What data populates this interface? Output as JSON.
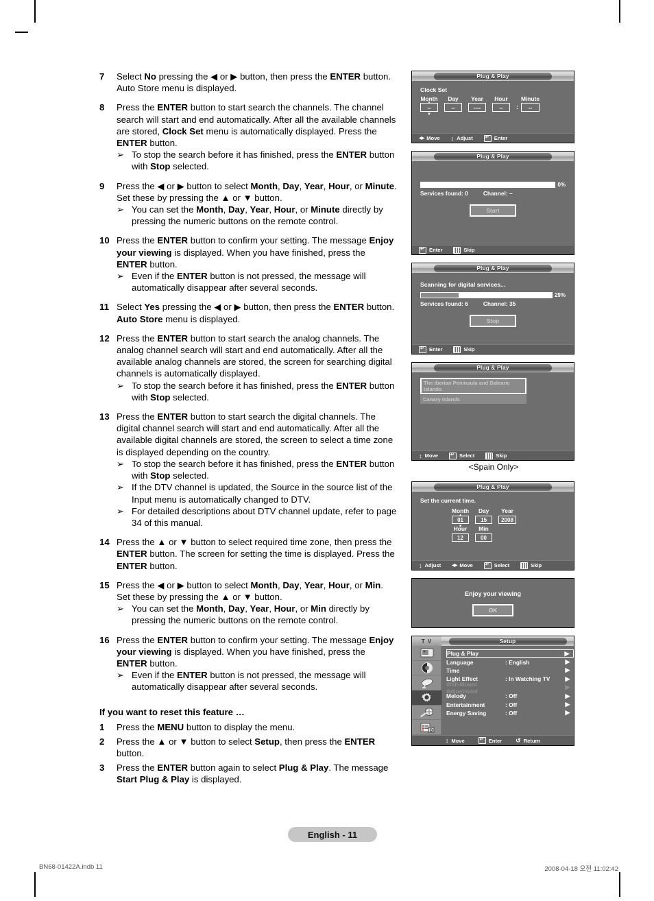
{
  "page": {
    "page_label": "English - 11",
    "footer_left": "BN68-01422A.indb   11",
    "footer_right": "2008-04-18   오전 11:02:42",
    "spain_caption": "<Spain Only>"
  },
  "steps": [
    {
      "num": "7",
      "lines": [
        "Select <b>No</b> pressing the ◀ or ▶ button, then press the <b>ENTER</b> button. Auto Store menu is displayed."
      ],
      "notes": []
    },
    {
      "num": "8",
      "lines": [
        "Press the <b>ENTER</b> button to start search the channels. The channel search will start and end automatically. After all the available channels are stored, <b>Clock Set</b> menu is automatically displayed. Press the <b>ENTER</b> button."
      ],
      "notes": [
        "To stop the search before it has finished, press the <b>ENTER</b> button with <b>Stop</b> selected."
      ]
    },
    {
      "num": "9",
      "lines": [
        "Press the ◀ or ▶ button to select <b>Month</b>, <b>Day</b>, <b>Year</b>, <b>Hour</b>, or <b>Minute</b>. Set these by pressing the ▲ or ▼ button."
      ],
      "notes": [
        "You can set the <b>Month</b>, <b>Day</b>, <b>Year</b>, <b>Hour</b>, or <b>Minute</b> directly by pressing the numeric buttons on the remote control."
      ]
    },
    {
      "num": "10",
      "lines": [
        "Press the <b>ENTER</b> button to confirm your setting. The message <b>Enjoy your viewing</b> is displayed. When you have finished, press the <b>ENTER</b> button."
      ],
      "notes": [
        "Even if the <b>ENTER</b> button is not pressed, the message will automatically disappear after several seconds."
      ]
    },
    {
      "num": "11",
      "lines": [
        "Select <b>Yes</b> pressing the ◀ or ▶ button, then press the <b>ENTER</b> button. <b>Auto Store</b> menu is displayed."
      ],
      "notes": []
    },
    {
      "num": "12",
      "lines": [
        "Press the <b>ENTER</b> button to start search the analog channels. The analog channel search will start and end automatically. After all the available analog channels are stored, the screen for searching digital channels is automatically displayed."
      ],
      "notes": [
        "To stop the search before it has finished, press the <b>ENTER</b> button with <b>Stop</b> selected."
      ]
    },
    {
      "num": "13",
      "lines": [
        "Press the <b>ENTER</b> button to start search the digital channels. The digital channel search will start and end automatically. After all the available digital channels are stored, the screen to select a time zone is displayed depending on the country."
      ],
      "notes": [
        "To stop the search before it has finished, press the <b>ENTER</b> button with <b>Stop</b> selected.",
        "If the DTV channel is updated, the Source in the source list of the Input menu is automatically changed to DTV.",
        "For detailed descriptions about DTV channel update, refer to page 34 of this manual."
      ]
    },
    {
      "num": "14",
      "lines": [
        "Press the ▲ or ▼ button to select required time zone, then press the <b>ENTER</b> button. The screen for setting the time is displayed. Press the <b>ENTER</b> button."
      ],
      "notes": []
    },
    {
      "num": "15",
      "lines": [
        "Press the ◀ or ▶ button to select <b>Month</b>, <b>Day</b>, <b>Year</b>, <b>Hour</b>, or <b>Min</b>. Set these by pressing the ▲ or ▼ button."
      ],
      "notes": [
        "You can set the <b>Month</b>, <b>Day</b>, <b>Year</b>, <b>Hour</b>, or <b>Min</b> directly by pressing the numeric buttons on the remote control."
      ]
    },
    {
      "num": "16",
      "lines": [
        "Press the <b>ENTER</b> button to confirm your setting. The message <b>Enjoy your viewing</b> is displayed. When you have finished, press the <b>ENTER</b> button."
      ],
      "notes": [
        "Even if the <b>ENTER</b> button is not pressed, the message will automatically disappear after several seconds."
      ]
    }
  ],
  "reset_section": {
    "heading": "If you want to reset this feature …",
    "steps": [
      {
        "num": "1",
        "lines": [
          "Press the <b>MENU</b> button to display the menu."
        ],
        "notes": []
      },
      {
        "num": "2",
        "lines": [
          "Press the ▲ or ▼ button to select <b>Setup</b>, then press the <b>ENTER</b> button."
        ],
        "notes": []
      },
      {
        "num": "3",
        "lines": [
          "Press the <b>ENTER</b> button again to select <b>Plug &amp; Play</b>. The message <b>Start Plug &amp; Play</b> is displayed."
        ],
        "notes": []
      }
    ]
  },
  "osd": {
    "title": "Plug & Play",
    "clock_set": {
      "label": "Clock Set",
      "fields": [
        {
          "header": "Month",
          "value": "--"
        },
        {
          "header": "Day",
          "value": "--"
        },
        {
          "header": "Year",
          "value": "----"
        },
        {
          "header": "Hour",
          "value": "--"
        },
        {
          "header": "Minute",
          "value": "--"
        }
      ],
      "separator": ":",
      "footer": [
        {
          "icon": "left-right-arrows-icon",
          "label": "Move"
        },
        {
          "icon": "up-down-arrows-icon",
          "label": "Adjust"
        },
        {
          "icon": "enter-key-icon",
          "label": "Enter"
        }
      ]
    },
    "auto_store_start": {
      "percent_label": "0%",
      "percent_value": 0,
      "services_found": "Services found: 0",
      "channel": "Channel: –",
      "button": "Start",
      "footer": [
        {
          "icon": "enter-key-icon",
          "label": "Enter"
        },
        {
          "icon": "skip-key-icon",
          "label": "Skip"
        }
      ]
    },
    "scanning": {
      "title": "Scanning for digital services...",
      "percent_label": "29%",
      "percent_value": 29,
      "services_found": "Services found: 6",
      "channel": "Channel: 35",
      "button": "Stop",
      "footer": [
        {
          "icon": "enter-key-icon",
          "label": "Enter"
        },
        {
          "icon": "skip-key-icon",
          "label": "Skip"
        }
      ]
    },
    "region_select": {
      "items": [
        {
          "label": "The Iberian Peninsula and Balearic Islands",
          "selected": true
        },
        {
          "label": "Canary Islands",
          "selected": false
        }
      ],
      "footer": [
        {
          "icon": "up-down-arrows-icon",
          "label": "Move"
        },
        {
          "icon": "enter-key-icon",
          "label": "Select"
        },
        {
          "icon": "skip-key-icon",
          "label": "Skip"
        }
      ]
    },
    "set_time": {
      "title": "Set the current time.",
      "row1": [
        {
          "header": "Month",
          "value": "01"
        },
        {
          "header": "Day",
          "value": "15"
        },
        {
          "header": "Year",
          "value": "2008"
        }
      ],
      "row2": [
        {
          "header": "Hour",
          "value": "12"
        },
        {
          "header": "Min",
          "value": "00"
        }
      ],
      "footer": [
        {
          "icon": "up-down-arrows-icon",
          "label": "Adjust"
        },
        {
          "icon": "left-right-arrows-icon",
          "label": "Move"
        },
        {
          "icon": "enter-key-icon",
          "label": "Select"
        },
        {
          "icon": "skip-key-icon",
          "label": "Skip"
        }
      ]
    },
    "enjoy": {
      "message": "Enjoy your viewing",
      "button": "OK"
    },
    "setup_menu": {
      "tv_label": "T V",
      "title": "Setup",
      "side_icons": [
        "picture-icon",
        "sound-icon",
        "channel-dish-icon",
        "setup-gear-icon",
        "input-icon",
        "dtv-list-icon"
      ],
      "items": [
        {
          "label": "Plug & Play",
          "value": "",
          "selected": true,
          "dim": false
        },
        {
          "label": "Language",
          "value": ": English",
          "selected": false,
          "dim": false
        },
        {
          "label": "Time",
          "value": "",
          "selected": false,
          "dim": false
        },
        {
          "label": "Light Effect",
          "value": ": In Watching TV",
          "selected": false,
          "dim": false
        },
        {
          "label": "Wall-Mount Adjustment",
          "value": "",
          "selected": false,
          "dim": true
        },
        {
          "label": "Melody",
          "value": ": Off",
          "selected": false,
          "dim": false
        },
        {
          "label": "Entertainment",
          "value": ": Off",
          "selected": false,
          "dim": false
        },
        {
          "label": "Energy Saving",
          "value": ": Off",
          "selected": false,
          "dim": false
        }
      ],
      "arrow": "▶",
      "footer": [
        {
          "icon": "up-down-arrows-icon",
          "label": "Move"
        },
        {
          "icon": "enter-key-icon",
          "label": "Enter"
        },
        {
          "icon": "return-key-icon",
          "label": "Return"
        }
      ]
    }
  }
}
